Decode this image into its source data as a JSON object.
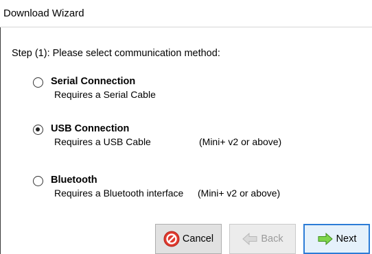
{
  "window": {
    "title": "Download Wizard"
  },
  "step": {
    "label": "Step (1): Please select communication method:"
  },
  "options": [
    {
      "title": "Serial Connection",
      "description": "Requires a Serial Cable",
      "note": "",
      "selected": false
    },
    {
      "title": "USB Connection",
      "description": "Requires a USB Cable",
      "note": "(Mini+ v2 or above)",
      "selected": true
    },
    {
      "title": "Bluetooth",
      "description": "Requires a Bluetooth interface",
      "note": "(Mini+ v2 or above)",
      "selected": false
    }
  ],
  "buttons": {
    "cancel": {
      "label": "Cancel",
      "icon": "cancel-icon",
      "enabled": true
    },
    "back": {
      "label": "Back",
      "icon": "back-arrow-icon",
      "enabled": false
    },
    "next": {
      "label": "Next",
      "icon": "next-arrow-icon",
      "enabled": true,
      "default": true
    }
  },
  "colors": {
    "cancel_icon": "#e03a2f",
    "next_arrow": "#7ed44a",
    "default_button_border": "#2b7bd6"
  }
}
